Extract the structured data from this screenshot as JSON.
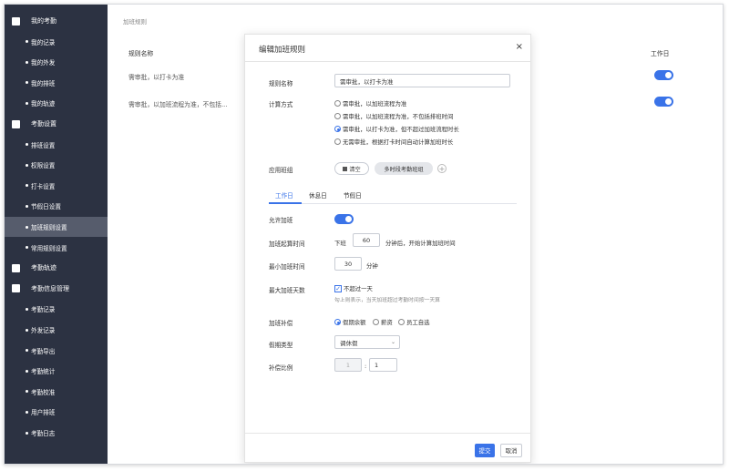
{
  "sidebar": {
    "items": [
      {
        "label": "我的考勤",
        "type": "group",
        "icon": "calendar-icon"
      },
      {
        "label": "我的记录",
        "type": "sub"
      },
      {
        "label": "我的外发",
        "type": "sub"
      },
      {
        "label": "我的排班",
        "type": "sub"
      },
      {
        "label": "我的轨迹",
        "type": "sub"
      },
      {
        "label": "考勤设置",
        "type": "group",
        "icon": "settings-doc-icon"
      },
      {
        "label": "排班设置",
        "type": "sub"
      },
      {
        "label": "权限设置",
        "type": "sub"
      },
      {
        "label": "打卡设置",
        "type": "sub"
      },
      {
        "label": "节假日设置",
        "type": "sub"
      },
      {
        "label": "加班规则设置",
        "type": "sub",
        "active": true
      },
      {
        "label": "常用规则设置",
        "type": "sub"
      },
      {
        "label": "考勤轨迹",
        "type": "group",
        "icon": "track-doc-icon"
      },
      {
        "label": "考勤信息管理",
        "type": "group",
        "icon": "info-doc-icon"
      },
      {
        "label": "考勤记录",
        "type": "sub"
      },
      {
        "label": "外发记录",
        "type": "sub"
      },
      {
        "label": "考勤导出",
        "type": "sub"
      },
      {
        "label": "考勤统计",
        "type": "sub"
      },
      {
        "label": "考勤校准",
        "type": "sub"
      },
      {
        "label": "用户排班",
        "type": "sub"
      },
      {
        "label": "考勤日志",
        "type": "sub"
      }
    ]
  },
  "background": {
    "breadcrumb": "加班规则",
    "column_name": "规则名称",
    "column_workday": "工作日",
    "rows": [
      {
        "name": "需审批，以打卡为准",
        "workday_on": true
      },
      {
        "name": "需审批，以加班流程为准，不包括...",
        "workday_on": true
      }
    ]
  },
  "modal": {
    "title": "编辑加班规则",
    "close": "×",
    "rule_name_label": "规则名称",
    "rule_name_value": "需审批，以打卡为准",
    "calc_label": "计算方式",
    "calc_options": [
      {
        "label": "需审批，以加班流程为准",
        "checked": false
      },
      {
        "label": "需审批，以加班流程为准，不包括排班时间",
        "checked": false
      },
      {
        "label": "需审批，以打卡为准，但不超过加班流程时长",
        "checked": true
      },
      {
        "label": "无需审批，根据打卡时间自动计算加班时长",
        "checked": false
      }
    ],
    "shift_label": "应用班组",
    "clear_button": "清空",
    "shift_tag": "多时段考勤班组",
    "add_symbol": "+",
    "tabs": [
      "工作日",
      "休息日",
      "节假日"
    ],
    "active_tab": 0,
    "allow_label": "允许加班",
    "allow_on": true,
    "start_label": "加班起算时间",
    "start_prefix": "下班",
    "start_value": "60",
    "start_suffix": "分钟后，开始计算加班时间",
    "min_label": "最小加班时间",
    "min_value": "30",
    "min_unit": "分钟",
    "maxdays_label": "最大加班天数",
    "maxdays_check": "不超过一天",
    "maxdays_checked": true,
    "maxdays_note": "勾上则表示，当天加班超过考勤时间按一天算",
    "comp_label": "加班补偿",
    "comp_options": [
      {
        "label": "假期余额",
        "checked": true
      },
      {
        "label": "薪资",
        "checked": false
      },
      {
        "label": "员工自选",
        "checked": false
      }
    ],
    "leave_type_label": "假期类型",
    "leave_type_value": "调休假",
    "ratio_label": "补偿比例",
    "ratio_left": "1",
    "ratio_sep": ":",
    "ratio_right": "1",
    "submit": "提交",
    "cancel": "取消"
  },
  "colors": {
    "accent": "#3a73e8",
    "sidebar": "#2c3242",
    "sidebar_active": "#565c6c"
  }
}
